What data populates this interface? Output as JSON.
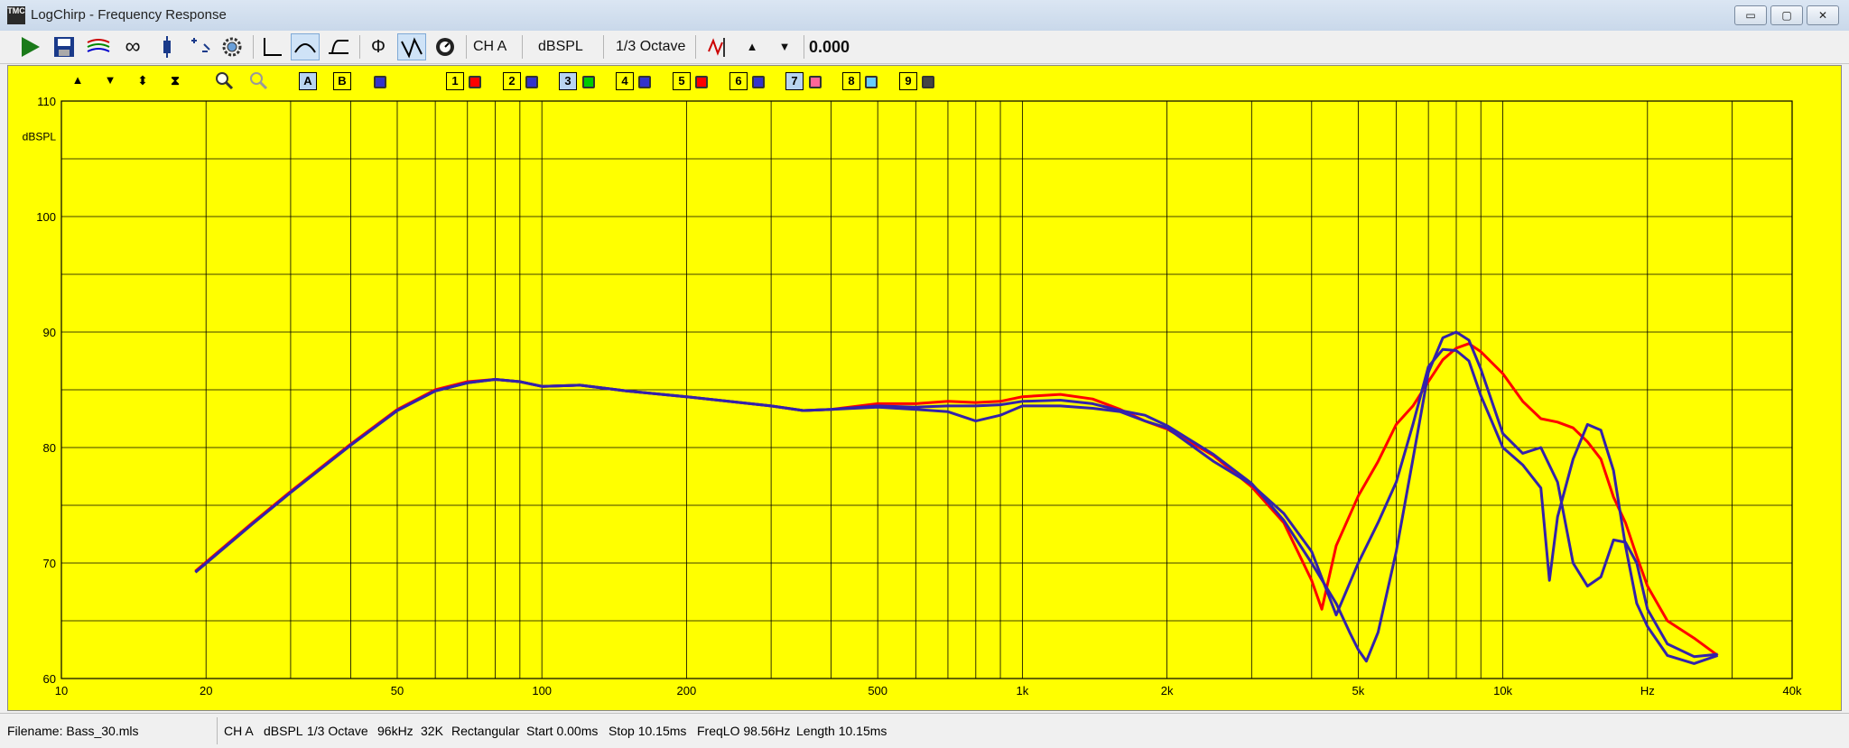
{
  "window": {
    "title": "LogChirp - Frequency Response",
    "app_icon_text": "TMC",
    "min_glyph": "▭",
    "max_glyph": "▢",
    "close_glyph": "✕"
  },
  "toolbar": {
    "channel": "CH A",
    "units": "dBSPL",
    "smoothing": "1/3 Octave",
    "value": "0.000"
  },
  "overlay_toolbar": {
    "buttons": [
      "A",
      "B"
    ],
    "traces": [
      "1",
      "2",
      "3",
      "4",
      "5",
      "6",
      "7",
      "8",
      "9"
    ],
    "trace_colors": [
      "#ff0000",
      "#3333cc",
      "#00cc00",
      "#3333cc",
      "#ff0000",
      "#3333cc",
      "#ff6699",
      "#66ccff",
      "#444444"
    ]
  },
  "status": {
    "filename": "Filename: Bass_30.mls",
    "channel": "CH A",
    "units": "dBSPL",
    "smoothing": "1/3 Octave",
    "rate": "96kHz",
    "size": "32K",
    "window": "Rectangular",
    "start": "Start 0.00ms",
    "stop": "Stop 10.15ms",
    "freqlo": "FreqLO 98.56Hz",
    "length": "Length 10.15ms"
  },
  "chart_data": {
    "type": "line",
    "title": "",
    "xlabel": "Hz",
    "ylabel": "dBSPL",
    "x_scale": "log",
    "xlim": [
      10,
      40000
    ],
    "ylim": [
      60,
      110
    ],
    "grid": true,
    "background": "#ffff00",
    "x_tick_labels": [
      {
        "value": 10,
        "label": "10"
      },
      {
        "value": 20,
        "label": "20"
      },
      {
        "value": 50,
        "label": "50"
      },
      {
        "value": 100,
        "label": "100"
      },
      {
        "value": 200,
        "label": "200"
      },
      {
        "value": 500,
        "label": "500"
      },
      {
        "value": 1000,
        "label": "1k"
      },
      {
        "value": 2000,
        "label": "2k"
      },
      {
        "value": 5000,
        "label": "5k"
      },
      {
        "value": 10000,
        "label": "10k"
      },
      {
        "value": 20000,
        "label": "Hz"
      },
      {
        "value": 40000,
        "label": "40k"
      }
    ],
    "y_tick_labels": [
      "60",
      "70",
      "80",
      "90",
      "100",
      "110"
    ],
    "series": [
      {
        "color": "#ff0000",
        "points": [
          [
            19,
            69.3
          ],
          [
            25,
            73.5
          ],
          [
            30,
            76.2
          ],
          [
            40,
            80.3
          ],
          [
            50,
            83.3
          ],
          [
            60,
            85.0
          ],
          [
            70,
            85.7
          ],
          [
            80,
            85.9
          ],
          [
            90,
            85.7
          ],
          [
            100,
            85.3
          ],
          [
            120,
            85.4
          ],
          [
            150,
            84.9
          ],
          [
            200,
            84.4
          ],
          [
            300,
            83.6
          ],
          [
            350,
            83.2
          ],
          [
            400,
            83.3
          ],
          [
            500,
            83.8
          ],
          [
            600,
            83.8
          ],
          [
            700,
            84.0
          ],
          [
            800,
            83.9
          ],
          [
            900,
            84.0
          ],
          [
            1000,
            84.4
          ],
          [
            1200,
            84.6
          ],
          [
            1400,
            84.2
          ],
          [
            1600,
            83.3
          ],
          [
            1800,
            82.3
          ],
          [
            2000,
            81.6
          ],
          [
            2500,
            79.3
          ],
          [
            3000,
            76.6
          ],
          [
            3500,
            73.5
          ],
          [
            4000,
            68.5
          ],
          [
            4200,
            66.0
          ],
          [
            4500,
            71.5
          ],
          [
            5000,
            75.8
          ],
          [
            5500,
            78.8
          ],
          [
            6000,
            82.0
          ],
          [
            6500,
            83.6
          ],
          [
            7000,
            85.7
          ],
          [
            7500,
            87.6
          ],
          [
            8000,
            88.6
          ],
          [
            8500,
            89.0
          ],
          [
            9000,
            88.3
          ],
          [
            10000,
            86.4
          ],
          [
            11000,
            84.0
          ],
          [
            12000,
            82.5
          ],
          [
            13000,
            82.2
          ],
          [
            14000,
            81.7
          ],
          [
            15000,
            80.5
          ],
          [
            16000,
            79.0
          ],
          [
            17000,
            75.7
          ],
          [
            18000,
            73.5
          ],
          [
            19000,
            70.6
          ],
          [
            20000,
            68.0
          ],
          [
            22000,
            65.0
          ],
          [
            25000,
            63.5
          ],
          [
            28000,
            62.0
          ]
        ]
      },
      {
        "color": "#3322aa",
        "points": [
          [
            19,
            69.2
          ],
          [
            25,
            73.4
          ],
          [
            30,
            76.1
          ],
          [
            40,
            80.2
          ],
          [
            50,
            83.2
          ],
          [
            60,
            84.9
          ],
          [
            70,
            85.6
          ],
          [
            80,
            85.9
          ],
          [
            90,
            85.7
          ],
          [
            100,
            85.3
          ],
          [
            120,
            85.4
          ],
          [
            150,
            84.9
          ],
          [
            200,
            84.4
          ],
          [
            300,
            83.6
          ],
          [
            350,
            83.2
          ],
          [
            400,
            83.3
          ],
          [
            500,
            83.6
          ],
          [
            600,
            83.5
          ],
          [
            700,
            83.6
          ],
          [
            800,
            83.6
          ],
          [
            900,
            83.7
          ],
          [
            1000,
            84.0
          ],
          [
            1200,
            84.1
          ],
          [
            1400,
            83.8
          ],
          [
            1600,
            83.2
          ],
          [
            1800,
            82.8
          ],
          [
            2000,
            81.9
          ],
          [
            2500,
            79.4
          ],
          [
            3000,
            76.9
          ],
          [
            3500,
            73.7
          ],
          [
            4000,
            70.0
          ],
          [
            4500,
            66.5
          ],
          [
            4800,
            64.0
          ],
          [
            5000,
            62.5
          ],
          [
            5200,
            61.5
          ],
          [
            5500,
            64.0
          ],
          [
            6000,
            71.0
          ],
          [
            6500,
            79.0
          ],
          [
            7000,
            86.5
          ],
          [
            7500,
            89.5
          ],
          [
            8000,
            90.0
          ],
          [
            8500,
            89.3
          ],
          [
            9000,
            86.8
          ],
          [
            10000,
            81.2
          ],
          [
            11000,
            79.5
          ],
          [
            12000,
            80.0
          ],
          [
            13000,
            77.0
          ],
          [
            14000,
            70.0
          ],
          [
            15000,
            68.0
          ],
          [
            16000,
            68.8
          ],
          [
            17000,
            72.0
          ],
          [
            18000,
            71.8
          ],
          [
            19000,
            70.0
          ],
          [
            20000,
            66.0
          ],
          [
            22000,
            63.0
          ],
          [
            25000,
            61.9
          ],
          [
            28000,
            62.1
          ]
        ]
      },
      {
        "color": "#3322aa",
        "points": [
          [
            19,
            69.2
          ],
          [
            25,
            73.4
          ],
          [
            30,
            76.1
          ],
          [
            40,
            80.2
          ],
          [
            50,
            83.2
          ],
          [
            60,
            84.9
          ],
          [
            70,
            85.6
          ],
          [
            80,
            85.9
          ],
          [
            90,
            85.7
          ],
          [
            100,
            85.3
          ],
          [
            120,
            85.4
          ],
          [
            150,
            84.9
          ],
          [
            200,
            84.4
          ],
          [
            300,
            83.6
          ],
          [
            350,
            83.2
          ],
          [
            400,
            83.3
          ],
          [
            500,
            83.5
          ],
          [
            600,
            83.3
          ],
          [
            700,
            83.1
          ],
          [
            800,
            82.3
          ],
          [
            900,
            82.8
          ],
          [
            1000,
            83.6
          ],
          [
            1200,
            83.6
          ],
          [
            1400,
            83.4
          ],
          [
            1600,
            83.1
          ],
          [
            1800,
            82.3
          ],
          [
            2000,
            81.7
          ],
          [
            2500,
            78.8
          ],
          [
            3000,
            76.8
          ],
          [
            3500,
            74.3
          ],
          [
            4000,
            71.0
          ],
          [
            4500,
            65.5
          ],
          [
            5000,
            70.0
          ],
          [
            5500,
            73.5
          ],
          [
            6000,
            77.0
          ],
          [
            6500,
            82.0
          ],
          [
            7000,
            87.0
          ],
          [
            7500,
            88.5
          ],
          [
            8000,
            88.4
          ],
          [
            8500,
            87.5
          ],
          [
            9000,
            84.5
          ],
          [
            10000,
            80.0
          ],
          [
            11000,
            78.5
          ],
          [
            12000,
            76.5
          ],
          [
            12500,
            68.5
          ],
          [
            13000,
            74.0
          ],
          [
            14000,
            79.0
          ],
          [
            15000,
            82.0
          ],
          [
            16000,
            81.5
          ],
          [
            17000,
            78.0
          ],
          [
            18000,
            71.5
          ],
          [
            19000,
            66.5
          ],
          [
            20000,
            64.5
          ],
          [
            22000,
            62.0
          ],
          [
            25000,
            61.3
          ],
          [
            28000,
            62.0
          ]
        ]
      }
    ]
  }
}
